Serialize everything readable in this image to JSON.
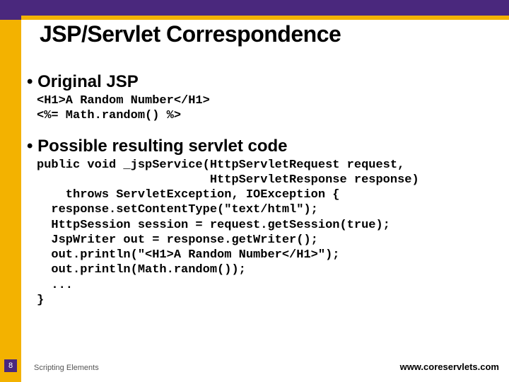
{
  "title": "JSP/Servlet Correspondence",
  "bullets": {
    "b1": "• Original JSP",
    "b2": "• Possible resulting servlet code"
  },
  "code1": "<H1>A Random Number</H1>\n<%= Math.random() %>",
  "code2": "public void _jspService(HttpServletRequest request,\n                        HttpServletResponse response)\n    throws ServletException, IOException {\n  response.setContentType(\"text/html\");\n  HttpSession session = request.getSession(true);\n  JspWriter out = response.getWriter();\n  out.println(\"<H1>A Random Number</H1>\");\n  out.println(Math.random());\n  ...\n}",
  "footer": {
    "page_number": "8",
    "label": "Scripting Elements",
    "url": "www.coreservlets.com"
  }
}
